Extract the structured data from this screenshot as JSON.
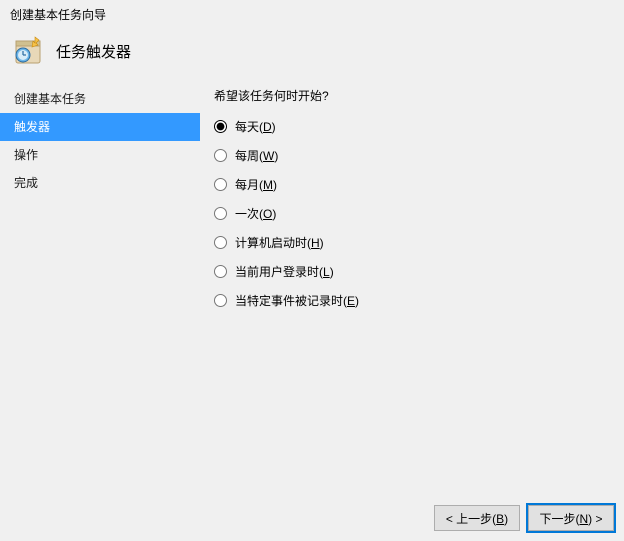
{
  "window": {
    "title": "创建基本任务向导"
  },
  "header": {
    "title": "任务触发器"
  },
  "sidebar": {
    "items": [
      {
        "label": "创建基本任务",
        "active": false
      },
      {
        "label": "触发器",
        "active": true
      },
      {
        "label": "操作",
        "active": false
      },
      {
        "label": "完成",
        "active": false
      }
    ]
  },
  "content": {
    "question": "希望该任务何时开始?",
    "options": [
      {
        "label": "每天",
        "accel": "D",
        "checked": true
      },
      {
        "label": "每周",
        "accel": "W",
        "checked": false
      },
      {
        "label": "每月",
        "accel": "M",
        "checked": false
      },
      {
        "label": "一次",
        "accel": "O",
        "checked": false
      },
      {
        "label": "计算机启动时",
        "accel": "H",
        "checked": false
      },
      {
        "label": "当前用户登录时",
        "accel": "L",
        "checked": false
      },
      {
        "label": "当特定事件被记录时",
        "accel": "E",
        "checked": false
      }
    ]
  },
  "footer": {
    "back_label": "< 上一步",
    "back_accel": "B",
    "next_label": "下一步",
    "next_accel": "N",
    "next_suffix": " >"
  }
}
